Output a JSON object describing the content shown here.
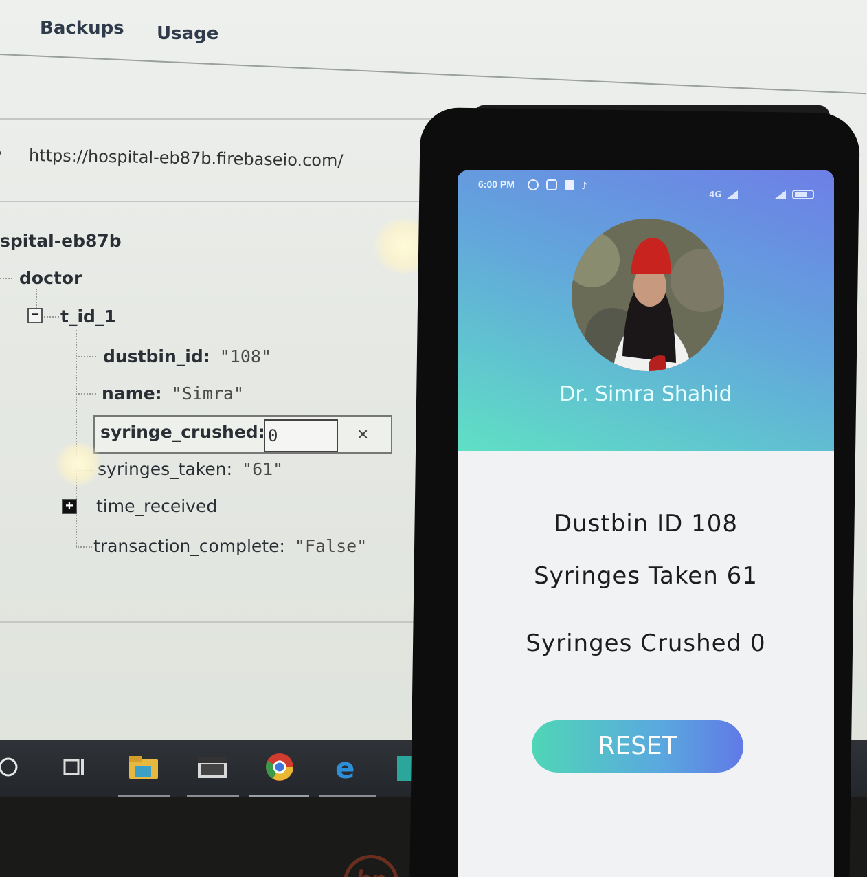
{
  "console": {
    "tabs": [
      "Backups",
      "Usage"
    ],
    "db_url": "https://hospital-eb87b.firebaseio.com/",
    "tree": {
      "root": "spital-eb87b",
      "doctor": "doctor",
      "child": "t_id_1",
      "fields": [
        {
          "key": "dustbin_id:",
          "value": "\"108\""
        },
        {
          "key": "name:",
          "value": "\"Simra\""
        },
        {
          "key": "syringe_crushed:",
          "value": "0"
        },
        {
          "key": "syringes_taken:",
          "value": "\"61\""
        },
        {
          "key": "time_received",
          "value": ""
        },
        {
          "key": "transaction_complete:",
          "value": "\"False\""
        }
      ],
      "edit_close": "×"
    }
  },
  "taskbar": {
    "icons": [
      "cortana-icon",
      "task-view-icon",
      "file-explorer-icon",
      "window-icon",
      "chrome-icon",
      "edge-icon",
      "app-icon"
    ]
  },
  "phone": {
    "status_time": "6:00 PM",
    "status_right": "4G",
    "doctor_name": "Dr. Simra Shahid",
    "dustbin_label": "Dustbin ID  108",
    "syringes_taken_label": "Syringes Taken 61",
    "syringes_crushed_label": "Syringes Crushed 0",
    "reset_label": "RESET"
  },
  "colors": {
    "header_top": "#6d7fe6",
    "header_bottom": "#5fe0c4",
    "button_left": "#4fd6b6",
    "button_right": "#6179e6"
  }
}
